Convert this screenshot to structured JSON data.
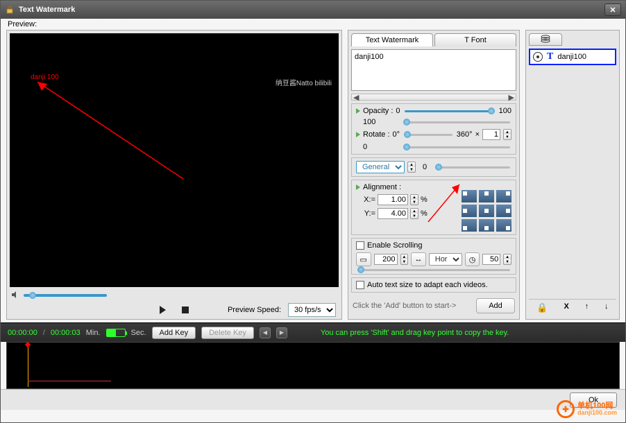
{
  "window": {
    "title": "Text Watermark"
  },
  "preview": {
    "label": "Preview:",
    "watermark_preview_text": "danji 100",
    "subtitle": "纳豆酱Natto bilibili"
  },
  "playback": {
    "speed_label": "Preview Speed:",
    "fps": "30 fps/s"
  },
  "tabs": {
    "text": "Text Watermark",
    "font": "T Font"
  },
  "watermark": {
    "text": "danji100",
    "opacity": {
      "label": "Opacity :",
      "min": "0",
      "max": "100",
      "value": "100"
    },
    "rotate": {
      "label": "Rotate  :",
      "min": "0°",
      "max": "360°",
      "times": "×",
      "spin_value": "1",
      "value": "0"
    },
    "mode": {
      "value": "General",
      "slider_value": "0"
    },
    "alignment": {
      "label": "Alignment :",
      "x_label": "X:=",
      "x_value": "1.00",
      "y_label": "Y:=",
      "y_value": "4.00",
      "pct": "%"
    },
    "scrolling": {
      "enable_label": "Enable Scrolling",
      "width": "200",
      "direction": "Horiz",
      "speed": "50"
    },
    "auto_size_label": "Auto text size to adapt each videos."
  },
  "add_section": {
    "hint": "Click the 'Add' button to start->",
    "button": "Add"
  },
  "layers": {
    "items": [
      {
        "name": "danji100"
      }
    ]
  },
  "timeline": {
    "current": "00:00:00",
    "slash": "/",
    "total": "00:00:03",
    "min_label": "Min.",
    "sec_label": "Sec.",
    "add_key": "Add Key",
    "delete_key": "Delete Key",
    "hint": "You can press 'Shift' and drag key point to copy the key."
  },
  "footer": {
    "ok": "Ok"
  },
  "brand": {
    "name": "单机100网",
    "site": "danji100.com"
  }
}
